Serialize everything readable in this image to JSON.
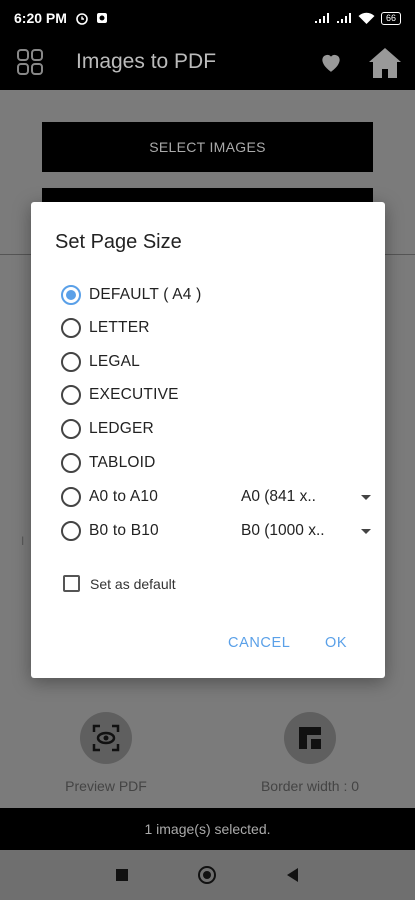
{
  "status_bar": {
    "time": "6:20 PM",
    "battery": "66"
  },
  "app_bar": {
    "title": "Images to PDF",
    "icons": [
      "grid-menu-icon",
      "heart-icon",
      "home-icon"
    ]
  },
  "main": {
    "select_images_label": "SELECT IMAGES",
    "ghost_char": "I",
    "tools": [
      {
        "label": "Preview PDF",
        "icon": "preview-scan-icon"
      },
      {
        "label": "Border width : 0",
        "icon": "border-icon"
      }
    ],
    "info": "1 image(s) selected."
  },
  "dialog": {
    "title": "Set Page Size",
    "options": [
      {
        "label": "DEFAULT ( A4 )",
        "checked": true
      },
      {
        "label": "LETTER",
        "checked": false
      },
      {
        "label": "LEGAL",
        "checked": false
      },
      {
        "label": "EXECUTIVE",
        "checked": false
      },
      {
        "label": "LEDGER",
        "checked": false
      },
      {
        "label": "TABLOID",
        "checked": false
      },
      {
        "label": "A0 to A10",
        "checked": false,
        "spinner": "A0 (841 x.."
      },
      {
        "label": "B0 to B10",
        "checked": false,
        "spinner": "B0 (1000 x.."
      }
    ],
    "set_default_label": "Set as default",
    "set_default_checked": false,
    "cancel_label": "CANCEL",
    "ok_label": "OK"
  },
  "colors": {
    "accent": "#5aa0e8",
    "scrim": "#7b7b7b"
  }
}
